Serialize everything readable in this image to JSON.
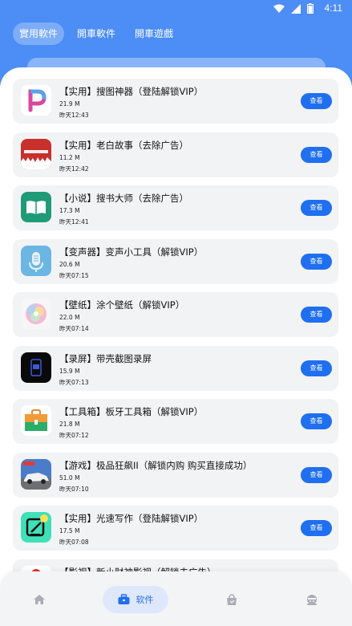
{
  "status": {
    "time": "4:11"
  },
  "topnav": [
    {
      "label": "實用軟件",
      "active": true
    },
    {
      "label": "開車軟件",
      "active": false
    },
    {
      "label": "開車遊戲",
      "active": false
    }
  ],
  "apps": [
    {
      "title": "【实用】搜图神器（登陆解锁VIP）",
      "size": "21.9 M",
      "date": "昨天12:43",
      "button": "查看",
      "icon": "picture-search-app-icon"
    },
    {
      "title": "【实用】老白故事（去除广告）",
      "size": "11.2 M",
      "date": "昨天12:42",
      "button": "查看",
      "icon": "laobai-story-app-icon"
    },
    {
      "title": "【小说】搜书大师（去除广告）",
      "size": "17.3 M",
      "date": "昨天12:41",
      "button": "查看",
      "icon": "book-app-icon"
    },
    {
      "title": "【变声器】变声小工具（解锁VIP）",
      "size": "20.6 M",
      "date": "昨天07:15",
      "button": "查看",
      "icon": "microphone-app-icon"
    },
    {
      "title": "【壁纸】涂个壁纸（解锁VIP）",
      "size": "22.0 M",
      "date": "昨天07:14",
      "button": "查看",
      "icon": "wallpaper-app-icon"
    },
    {
      "title": "【录屏】带壳截图录屏",
      "size": "15.9 M",
      "date": "昨天07:13",
      "button": "查看",
      "icon": "screen-record-app-icon"
    },
    {
      "title": "【工具箱】板牙工具箱（解锁VIP）",
      "size": "21.8 M",
      "date": "昨天07:12",
      "button": "查看",
      "icon": "toolbox-app-icon"
    },
    {
      "title": "【游戏】极品狂飙II（解锁内购 购买直接成功）",
      "size": "51.0 M",
      "date": "昨天07:10",
      "button": "查看",
      "icon": "racing-game-app-icon"
    },
    {
      "title": "【实用】光速写作（登陆解锁VIP）",
      "size": "17.5 M",
      "date": "昨天07:08",
      "button": "查看",
      "icon": "ai-writing-app-icon"
    },
    {
      "title": "【影视】新小财神影视（解锁去广告）",
      "size": "",
      "date": "",
      "button": "",
      "icon": "video-app-icon"
    }
  ],
  "bottomnav": [
    {
      "icon": "home-icon",
      "label": ""
    },
    {
      "icon": "briefcase-icon",
      "label": "软件"
    },
    {
      "icon": "bag-icon",
      "label": ""
    },
    {
      "icon": "user-icon",
      "label": ""
    }
  ],
  "colors": {
    "primary": "#1f6ff0",
    "header": "#4c8df6"
  }
}
